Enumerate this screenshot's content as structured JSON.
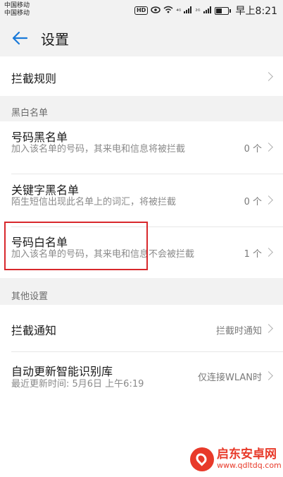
{
  "status_bar": {
    "carrier_1": "中国移动",
    "carrier_2": "中国移动",
    "hd": "HD",
    "signal_1": "⁴ᴳ",
    "signal_2": "²ᴳ",
    "time": "早上8:21"
  },
  "header": {
    "title": "设置"
  },
  "rows": {
    "intercept_rules": {
      "title": "拦截规则"
    },
    "blacklist_section": {
      "title": "黑白名单"
    },
    "number_blacklist": {
      "title": "号码黑名单",
      "subtitle": "加入该名单的号码，其来电和信息将被拦截",
      "value": "0 个"
    },
    "keyword_blacklist": {
      "title": "关键字黑名单",
      "subtitle": "陌生短信出现此名单上的词汇，将被拦截",
      "value": "0 个"
    },
    "number_whitelist": {
      "title": "号码白名单",
      "subtitle": "加入该名单的号码，其来电和信息不会被拦截",
      "value": "1 个"
    },
    "other_section": {
      "title": "其他设置"
    },
    "intercept_notify": {
      "title": "拦截通知",
      "value": "拦截时通知"
    },
    "auto_update": {
      "title": "自动更新智能识别库",
      "subtitle": "最近更新时间: 5月6日 上午6:19",
      "value": "仅连接WLAN时"
    }
  },
  "watermark": {
    "name": "启东安卓网",
    "url": "www.qdltdq.com"
  },
  "colors": {
    "accent": "#1a7ad9",
    "highlight": "#d8282c",
    "watermark": "#e83a2a"
  }
}
